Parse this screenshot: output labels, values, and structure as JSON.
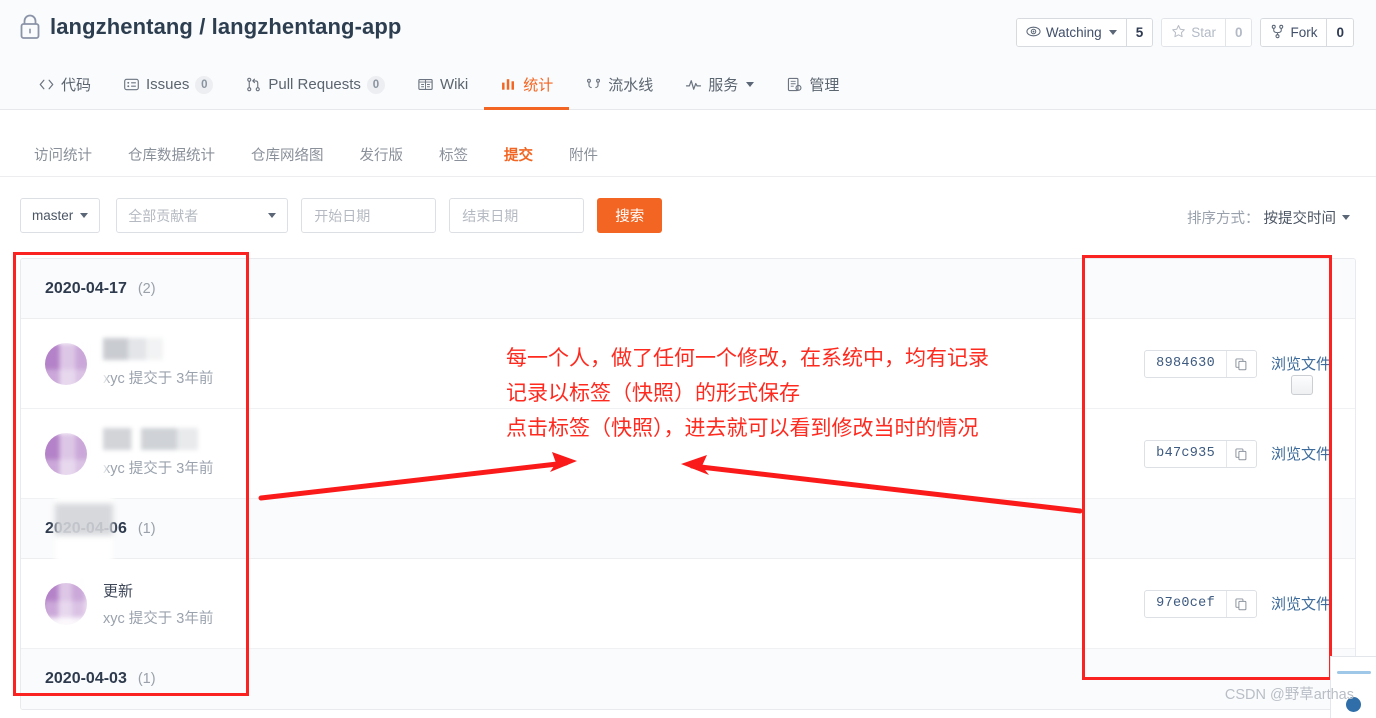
{
  "header": {
    "lock_icon": "lock-icon",
    "owner": "langzhentang",
    "separator": "/",
    "repo": "langzhentang-app",
    "full_title": "langzhentang / langzhentang-app",
    "actions": [
      {
        "icon": "eye-icon",
        "label": "Watching",
        "has_caret": true,
        "count": "5",
        "muted": false
      },
      {
        "icon": "star-icon",
        "label": "Star",
        "has_caret": false,
        "count": "0",
        "muted": true
      },
      {
        "icon": "fork-icon",
        "label": "Fork",
        "has_caret": false,
        "count": "0",
        "muted": false
      }
    ]
  },
  "primary_nav": [
    {
      "icon": "code-icon",
      "label": "代码",
      "count": null,
      "active": false,
      "caret": false
    },
    {
      "icon": "issues-icon",
      "label": "Issues",
      "count": "0",
      "active": false,
      "caret": false
    },
    {
      "icon": "pull-request-icon",
      "label": "Pull Requests",
      "count": "0",
      "active": false,
      "caret": false
    },
    {
      "icon": "wiki-icon",
      "label": "Wiki",
      "count": null,
      "active": false,
      "caret": false
    },
    {
      "icon": "stats-icon",
      "label": "统计",
      "count": null,
      "active": true,
      "caret": false
    },
    {
      "icon": "pipeline-icon",
      "label": "流水线",
      "count": null,
      "active": false,
      "caret": false
    },
    {
      "icon": "service-icon",
      "label": "服务",
      "count": null,
      "active": false,
      "caret": true
    },
    {
      "icon": "manage-icon",
      "label": "管理",
      "count": null,
      "active": false,
      "caret": false
    }
  ],
  "sub_nav": [
    {
      "label": "访问统计",
      "active": false
    },
    {
      "label": "仓库数据统计",
      "active": false
    },
    {
      "label": "仓库网络图",
      "active": false
    },
    {
      "label": "发行版",
      "active": false
    },
    {
      "label": "标签",
      "active": false
    },
    {
      "label": "提交",
      "active": true
    },
    {
      "label": "附件",
      "active": false
    }
  ],
  "filter_bar": {
    "branch": "master",
    "contributor_placeholder": "全部贡献者",
    "start_date_placeholder": "开始日期",
    "end_date_placeholder": "结束日期",
    "search_button": "搜索",
    "sort_label": "排序方式：",
    "sort_value": "按提交时间"
  },
  "commit_groups": [
    {
      "date": "2020-04-17",
      "count_label": "(2)",
      "date_redacted": false,
      "commits": [
        {
          "message": "",
          "message_redacted": true,
          "message_width": "narrow",
          "meta": "xyc 提交于 3年前",
          "sha": "8984630",
          "copy_icon": "copy-icon",
          "browse_label": "浏览文件"
        },
        {
          "message": "",
          "message_redacted": true,
          "message_width": "wide",
          "meta": "xyc 提交于 3年前",
          "sha": "b47c935",
          "copy_icon": "copy-icon",
          "browse_label": "浏览文件"
        }
      ]
    },
    {
      "date": "2020-04-06",
      "count_label": "(1)",
      "date_redacted": true,
      "commits": [
        {
          "message": "更新",
          "message_redacted": false,
          "message_width": "auto",
          "meta": "xyc 提交于 3年前",
          "sha": "97e0cef",
          "copy_icon": "copy-icon",
          "browse_label": "浏览文件"
        }
      ]
    },
    {
      "date": "2020-04-03",
      "count_label": "(1)",
      "date_redacted": false,
      "commits": []
    }
  ],
  "annotations": {
    "line1": "每一个人，做了任何一个修改，在系统中，均有记录",
    "line2": "记录以标签（快照）的形式保存",
    "line3": "点击标签（快照），进去就可以看到修改当时的情况",
    "color": "#ff2a1f",
    "highlight_boxes": [
      {
        "name": "commit-list-highlight"
      },
      {
        "name": "commit-sha-highlight"
      }
    ],
    "arrows": [
      {
        "name": "arrow-to-commit-list",
        "direction": "right"
      },
      {
        "name": "arrow-to-sha-column",
        "direction": "left"
      }
    ]
  },
  "watermark": "CSDN @野草arthas",
  "colors": {
    "accent": "#f26522",
    "annotation_red": "#ff2a1f",
    "link_blue": "#3d6b9c",
    "avatar_purple": "#9b59b6"
  }
}
